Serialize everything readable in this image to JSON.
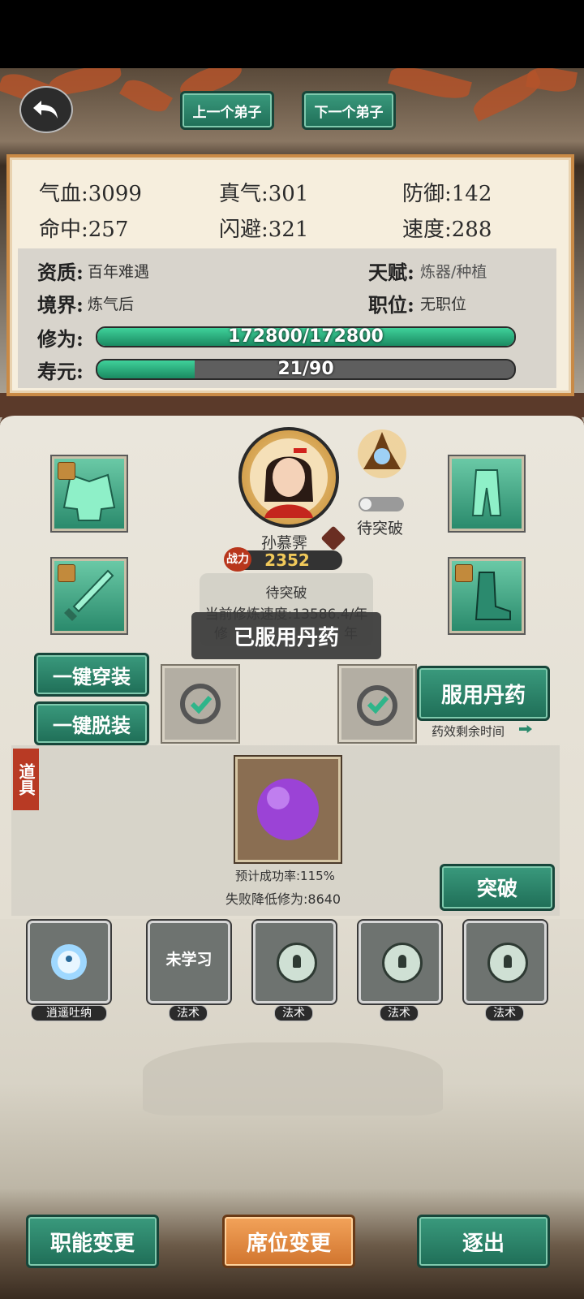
{
  "nav": {
    "prev_label": "上一个弟子",
    "next_label": "下一个弟子"
  },
  "stats": {
    "qixue": "气血:3099",
    "zhenqi": "真气:301",
    "fangyu": "防御:142",
    "mingzhong": "命中:257",
    "shanbi": "闪避:321",
    "sudu": "速度:288"
  },
  "info": {
    "zizhi_key": "资质:",
    "zizhi_val": "百年难遇",
    "tianfu_key": "天赋:",
    "tianfu_val": "炼器/种植",
    "jingjie_key": "境界:",
    "jingjie_val": "炼气后",
    "zhiwei_key": "职位:",
    "zhiwei_val": "无职位",
    "xiuwei_key": "修为:",
    "xiuwei_text": "172800/172800",
    "xiuwei_progress": 1.0,
    "shouyuan_key": "寿元:",
    "shouyuan_text": "21/90",
    "shouyuan_progress": 0.233
  },
  "character": {
    "name": "孙慕霁",
    "power_badge": "战力",
    "power": "2352",
    "status": "待突破",
    "speed_line": "当前修炼速度:13586.4/年",
    "speed_line2_left": "修",
    "speed_line2_right": "年"
  },
  "toast": "已服用丹药",
  "buttons": {
    "equip_all": "一键穿装",
    "unequip_all": "一键脱装",
    "take_pill": "服用丹药",
    "pill_remaining": "药效剩余时间",
    "breakthrough": "突破",
    "job_change": "职能变更",
    "seat_change": "席位变更",
    "expel": "逐出"
  },
  "items": {
    "tab": "道具",
    "success_rate": "预计成功率:115%",
    "fail_penalty": "失败降低修为:8640"
  },
  "skills": [
    {
      "label": "逍遥吐纳",
      "state": "learned"
    },
    {
      "label": "法术",
      "state": "未学习"
    },
    {
      "label": "法术",
      "state": "locked"
    },
    {
      "label": "法术",
      "state": "locked"
    },
    {
      "label": "法术",
      "state": "locked"
    }
  ],
  "colors": {
    "accent_green": "#2a8a6c",
    "accent_orange": "#e08a3c",
    "gold": "#f1c95a"
  }
}
